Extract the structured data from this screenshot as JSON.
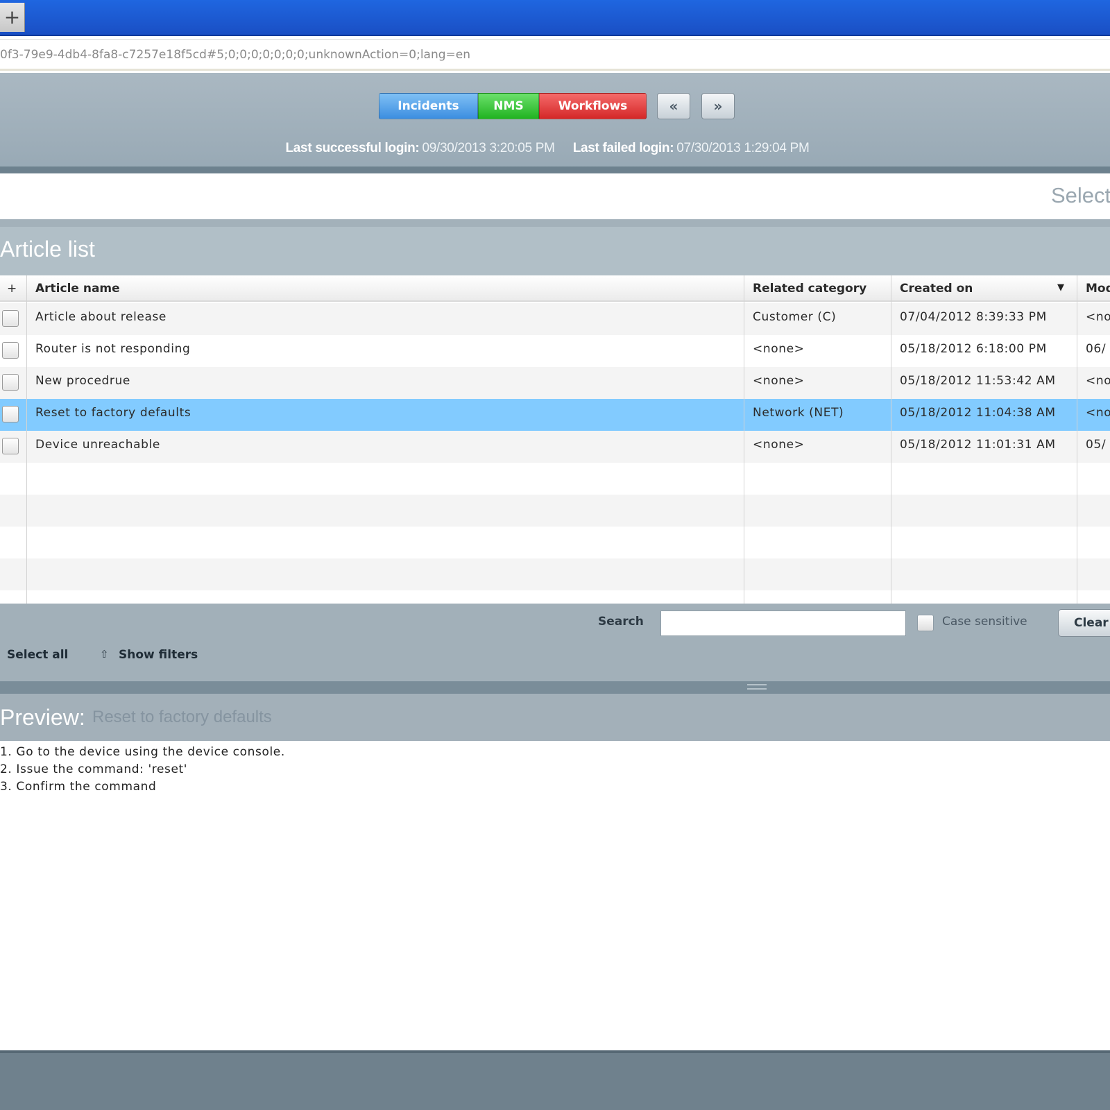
{
  "browser": {
    "new_tab_label": "+",
    "address": "0f3-79e9-4db4-8fa8-c7257e18f5cd#5;0;0;0;0;0;0;0;unknownAction=0;lang=en"
  },
  "header": {
    "tabs": [
      {
        "label": "Incidents",
        "color": "#3c8ee0"
      },
      {
        "label": "NMS",
        "color": "#21b321"
      },
      {
        "label": "Workflows",
        "color": "#d42828"
      }
    ],
    "prev_label": "«",
    "next_label": "»",
    "last_successful_login_label": "Last successful login:",
    "last_successful_login_value": "09/30/2013 3:20:05 PM",
    "last_failed_login_label": "Last failed login:",
    "last_failed_login_value": "07/30/2013 1:29:04 PM"
  },
  "select_label": "Select",
  "article_list": {
    "title": "Article list",
    "add_column_icon": "+",
    "columns": [
      "Article name",
      "Related category",
      "Created on",
      "Mod"
    ],
    "sort_indicator": "▼",
    "rows": [
      {
        "name": "Article about release",
        "category": "Customer (C)",
        "created": "07/04/2012 8:39:33 PM",
        "modified": "<no"
      },
      {
        "name": "Router is not responding",
        "category": "<none>",
        "created": "05/18/2012 6:18:00 PM",
        "modified": "06/"
      },
      {
        "name": "New procedrue",
        "category": "<none>",
        "created": "05/18/2012 11:53:42 AM",
        "modified": "<no"
      },
      {
        "name": "Reset to factory defaults",
        "category": "Network (NET)",
        "created": "05/18/2012 11:04:38 AM",
        "modified": "<no",
        "selected": true
      },
      {
        "name": "Device unreachable",
        "category": "<none>",
        "created": "05/18/2012 11:01:31 AM",
        "modified": "05/"
      }
    ]
  },
  "toolbar": {
    "search_label": "Search",
    "search_value": "",
    "case_sensitive_label": "Case sensitive",
    "clear_label": "Clear",
    "select_all_label": "Select all",
    "show_filters_label": "Show filters",
    "show_filters_icon": "chevron-up-double-icon"
  },
  "preview": {
    "title": "Preview:",
    "subject": "Reset to factory defaults",
    "lines": [
      "1. Go to the device using the device console.",
      "2. Issue the command: 'reset'",
      "3. Confirm the command"
    ]
  },
  "colors": {
    "selected_row": "#82cbff",
    "incidents": "#3c8ee0",
    "nms": "#21b321",
    "workflows": "#d42828"
  }
}
